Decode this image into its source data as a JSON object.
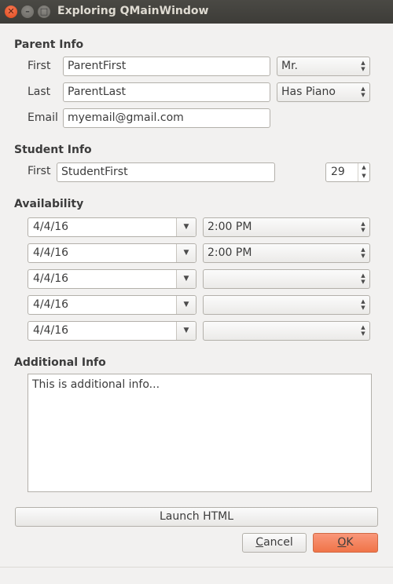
{
  "window": {
    "title": "Exploring QMainWindow"
  },
  "parent": {
    "heading": "Parent Info",
    "first_label": "First",
    "first_value": "ParentFirst",
    "last_label": "Last",
    "last_value": "ParentLast",
    "email_label": "Email",
    "email_value": "myemail@gmail.com",
    "title_select": "Mr.",
    "piano_select": "Has Piano"
  },
  "student": {
    "heading": "Student Info",
    "first_label": "First",
    "first_value": "StudentFirst",
    "age_value": "29"
  },
  "availability": {
    "heading": "Availability",
    "rows": [
      {
        "date": "4/4/16",
        "time": "2:00 PM"
      },
      {
        "date": "4/4/16",
        "time": "2:00 PM"
      },
      {
        "date": "4/4/16",
        "time": ""
      },
      {
        "date": "4/4/16",
        "time": ""
      },
      {
        "date": "4/4/16",
        "time": ""
      }
    ]
  },
  "additional": {
    "heading": "Additional Info",
    "text": "This is additional info..."
  },
  "buttons": {
    "launch": "Launch HTML",
    "cancel_first": "C",
    "cancel_rest": "ancel",
    "ok_first": "O",
    "ok_rest": "K"
  },
  "icons": {
    "close": "close-icon",
    "minimize": "minimize-icon",
    "maximize": "maximize-icon",
    "spin": "spin-arrows-icon",
    "dropdown": "chevron-down-icon"
  }
}
